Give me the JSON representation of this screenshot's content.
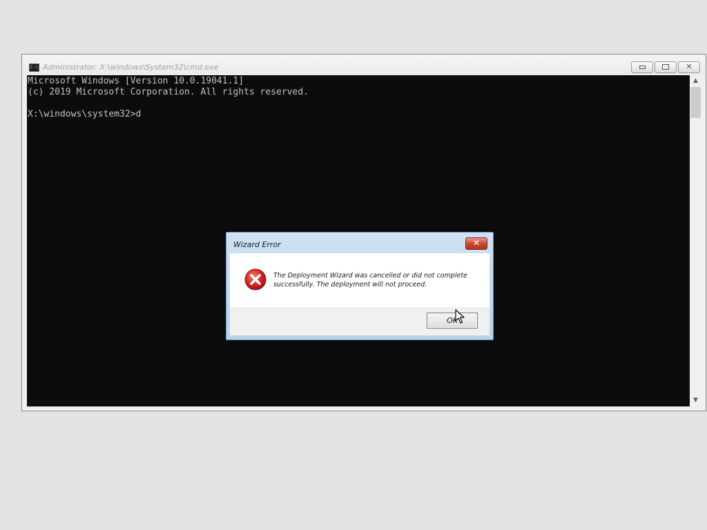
{
  "cmd_window": {
    "title": "Administrator: X:\\windows\\System32\\cmd.exe",
    "icon": "console-icon",
    "icon_text": "C:\\",
    "caption_buttons": {
      "minimize": "minimize-icon",
      "maximize": "restore-icon",
      "close": "close-icon",
      "close_glyph": "✕"
    },
    "console_lines": [
      "Microsoft Windows [Version 10.0.19041.1]",
      "(c) 2019 Microsoft Corporation. All rights reserved.",
      "",
      "X:\\windows\\system32>d"
    ],
    "scrollbar": {
      "up_glyph": "▲",
      "down_glyph": "▼"
    }
  },
  "dialog": {
    "title": "Wizard Error",
    "close_glyph": "✕",
    "icon": "error-icon",
    "message": "The Deployment Wizard was cancelled or did not complete successfully.  The deployment will not proceed.",
    "ok_label": "OK"
  },
  "colors": {
    "console_bg": "#0c0c0c",
    "console_text": "#c0c0c0",
    "error_red": "#d42020",
    "dialog_frame": "#bcd4ec"
  }
}
